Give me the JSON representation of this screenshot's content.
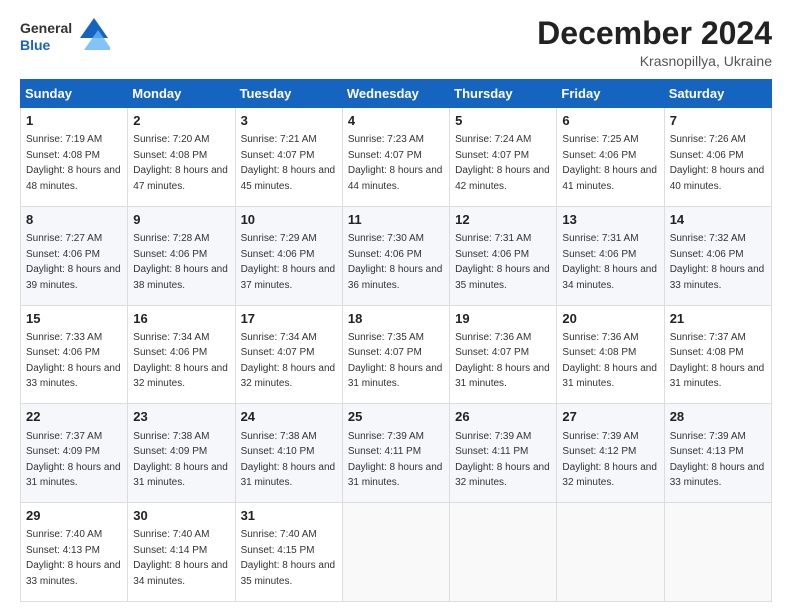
{
  "logo": {
    "general": "General",
    "blue": "Blue"
  },
  "header": {
    "month": "December 2024",
    "location": "Krasnopillya, Ukraine"
  },
  "weekdays": [
    "Sunday",
    "Monday",
    "Tuesday",
    "Wednesday",
    "Thursday",
    "Friday",
    "Saturday"
  ],
  "weeks": [
    [
      {
        "day": "1",
        "sunrise": "7:19 AM",
        "sunset": "4:08 PM",
        "daylight": "8 hours and 48 minutes."
      },
      {
        "day": "2",
        "sunrise": "7:20 AM",
        "sunset": "4:08 PM",
        "daylight": "8 hours and 47 minutes."
      },
      {
        "day": "3",
        "sunrise": "7:21 AM",
        "sunset": "4:07 PM",
        "daylight": "8 hours and 45 minutes."
      },
      {
        "day": "4",
        "sunrise": "7:23 AM",
        "sunset": "4:07 PM",
        "daylight": "8 hours and 44 minutes."
      },
      {
        "day": "5",
        "sunrise": "7:24 AM",
        "sunset": "4:07 PM",
        "daylight": "8 hours and 42 minutes."
      },
      {
        "day": "6",
        "sunrise": "7:25 AM",
        "sunset": "4:06 PM",
        "daylight": "8 hours and 41 minutes."
      },
      {
        "day": "7",
        "sunrise": "7:26 AM",
        "sunset": "4:06 PM",
        "daylight": "8 hours and 40 minutes."
      }
    ],
    [
      {
        "day": "8",
        "sunrise": "7:27 AM",
        "sunset": "4:06 PM",
        "daylight": "8 hours and 39 minutes."
      },
      {
        "day": "9",
        "sunrise": "7:28 AM",
        "sunset": "4:06 PM",
        "daylight": "8 hours and 38 minutes."
      },
      {
        "day": "10",
        "sunrise": "7:29 AM",
        "sunset": "4:06 PM",
        "daylight": "8 hours and 37 minutes."
      },
      {
        "day": "11",
        "sunrise": "7:30 AM",
        "sunset": "4:06 PM",
        "daylight": "8 hours and 36 minutes."
      },
      {
        "day": "12",
        "sunrise": "7:31 AM",
        "sunset": "4:06 PM",
        "daylight": "8 hours and 35 minutes."
      },
      {
        "day": "13",
        "sunrise": "7:31 AM",
        "sunset": "4:06 PM",
        "daylight": "8 hours and 34 minutes."
      },
      {
        "day": "14",
        "sunrise": "7:32 AM",
        "sunset": "4:06 PM",
        "daylight": "8 hours and 33 minutes."
      }
    ],
    [
      {
        "day": "15",
        "sunrise": "7:33 AM",
        "sunset": "4:06 PM",
        "daylight": "8 hours and 33 minutes."
      },
      {
        "day": "16",
        "sunrise": "7:34 AM",
        "sunset": "4:06 PM",
        "daylight": "8 hours and 32 minutes."
      },
      {
        "day": "17",
        "sunrise": "7:34 AM",
        "sunset": "4:07 PM",
        "daylight": "8 hours and 32 minutes."
      },
      {
        "day": "18",
        "sunrise": "7:35 AM",
        "sunset": "4:07 PM",
        "daylight": "8 hours and 31 minutes."
      },
      {
        "day": "19",
        "sunrise": "7:36 AM",
        "sunset": "4:07 PM",
        "daylight": "8 hours and 31 minutes."
      },
      {
        "day": "20",
        "sunrise": "7:36 AM",
        "sunset": "4:08 PM",
        "daylight": "8 hours and 31 minutes."
      },
      {
        "day": "21",
        "sunrise": "7:37 AM",
        "sunset": "4:08 PM",
        "daylight": "8 hours and 31 minutes."
      }
    ],
    [
      {
        "day": "22",
        "sunrise": "7:37 AM",
        "sunset": "4:09 PM",
        "daylight": "8 hours and 31 minutes."
      },
      {
        "day": "23",
        "sunrise": "7:38 AM",
        "sunset": "4:09 PM",
        "daylight": "8 hours and 31 minutes."
      },
      {
        "day": "24",
        "sunrise": "7:38 AM",
        "sunset": "4:10 PM",
        "daylight": "8 hours and 31 minutes."
      },
      {
        "day": "25",
        "sunrise": "7:39 AM",
        "sunset": "4:11 PM",
        "daylight": "8 hours and 31 minutes."
      },
      {
        "day": "26",
        "sunrise": "7:39 AM",
        "sunset": "4:11 PM",
        "daylight": "8 hours and 32 minutes."
      },
      {
        "day": "27",
        "sunrise": "7:39 AM",
        "sunset": "4:12 PM",
        "daylight": "8 hours and 32 minutes."
      },
      {
        "day": "28",
        "sunrise": "7:39 AM",
        "sunset": "4:13 PM",
        "daylight": "8 hours and 33 minutes."
      }
    ],
    [
      {
        "day": "29",
        "sunrise": "7:40 AM",
        "sunset": "4:13 PM",
        "daylight": "8 hours and 33 minutes."
      },
      {
        "day": "30",
        "sunrise": "7:40 AM",
        "sunset": "4:14 PM",
        "daylight": "8 hours and 34 minutes."
      },
      {
        "day": "31",
        "sunrise": "7:40 AM",
        "sunset": "4:15 PM",
        "daylight": "8 hours and 35 minutes."
      },
      null,
      null,
      null,
      null
    ]
  ],
  "labels": {
    "sunrise": "Sunrise:",
    "sunset": "Sunset:",
    "daylight": "Daylight:"
  }
}
